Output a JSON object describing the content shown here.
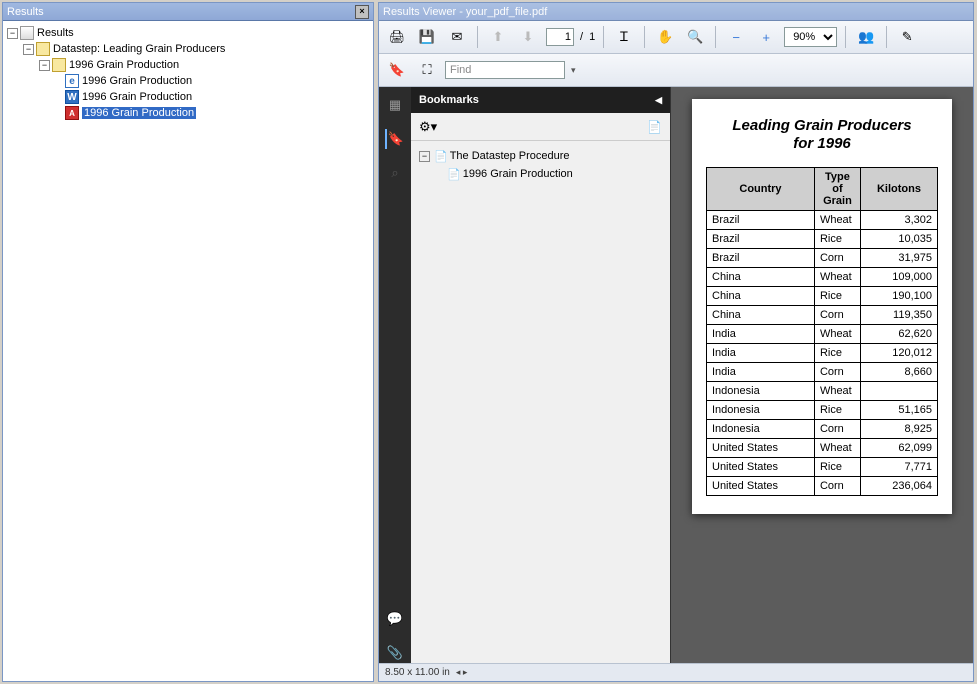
{
  "left": {
    "title": "Results",
    "root": "Results",
    "datastep": "Datastep:  Leading Grain Producers",
    "folder": "1996 Grain Production",
    "item_ie": "1996 Grain Production",
    "item_word": "1996 Grain Production",
    "item_pdf": "1996 Grain Production"
  },
  "viewer": {
    "title": "Results Viewer - your_pdf_file.pdf",
    "page_current": "1",
    "page_total": "1",
    "page_sep": "/",
    "zoom": "90%",
    "find_placeholder": "Find"
  },
  "bookmarks": {
    "header": "Bookmarks",
    "root": "The Datastep Procedure",
    "child": "1996 Grain Production"
  },
  "pdf": {
    "title_line1": "Leading Grain Producers",
    "title_line2": "for 1996",
    "headers": {
      "country": "Country",
      "grain": "Type of Grain",
      "kilotons": "Kilotons"
    }
  },
  "chart_data": {
    "type": "table",
    "title": "Leading Grain Producers for 1996",
    "columns": [
      "Country",
      "Type of Grain",
      "Kilotons"
    ],
    "rows": [
      {
        "country": "Brazil",
        "grain": "Wheat",
        "kilotons": "3,302"
      },
      {
        "country": "Brazil",
        "grain": "Rice",
        "kilotons": "10,035"
      },
      {
        "country": "Brazil",
        "grain": "Corn",
        "kilotons": "31,975"
      },
      {
        "country": "China",
        "grain": "Wheat",
        "kilotons": "109,000"
      },
      {
        "country": "China",
        "grain": "Rice",
        "kilotons": "190,100"
      },
      {
        "country": "China",
        "grain": "Corn",
        "kilotons": "119,350"
      },
      {
        "country": "India",
        "grain": "Wheat",
        "kilotons": "62,620"
      },
      {
        "country": "India",
        "grain": "Rice",
        "kilotons": "120,012"
      },
      {
        "country": "India",
        "grain": "Corn",
        "kilotons": "8,660"
      },
      {
        "country": "Indonesia",
        "grain": "Wheat",
        "kilotons": ""
      },
      {
        "country": "Indonesia",
        "grain": "Rice",
        "kilotons": "51,165"
      },
      {
        "country": "Indonesia",
        "grain": "Corn",
        "kilotons": "8,925"
      },
      {
        "country": "United States",
        "grain": "Wheat",
        "kilotons": "62,099"
      },
      {
        "country": "United States",
        "grain": "Rice",
        "kilotons": "7,771"
      },
      {
        "country": "United States",
        "grain": "Corn",
        "kilotons": "236,064"
      }
    ]
  },
  "status": {
    "dimensions": "8.50 x 11.00 in"
  }
}
